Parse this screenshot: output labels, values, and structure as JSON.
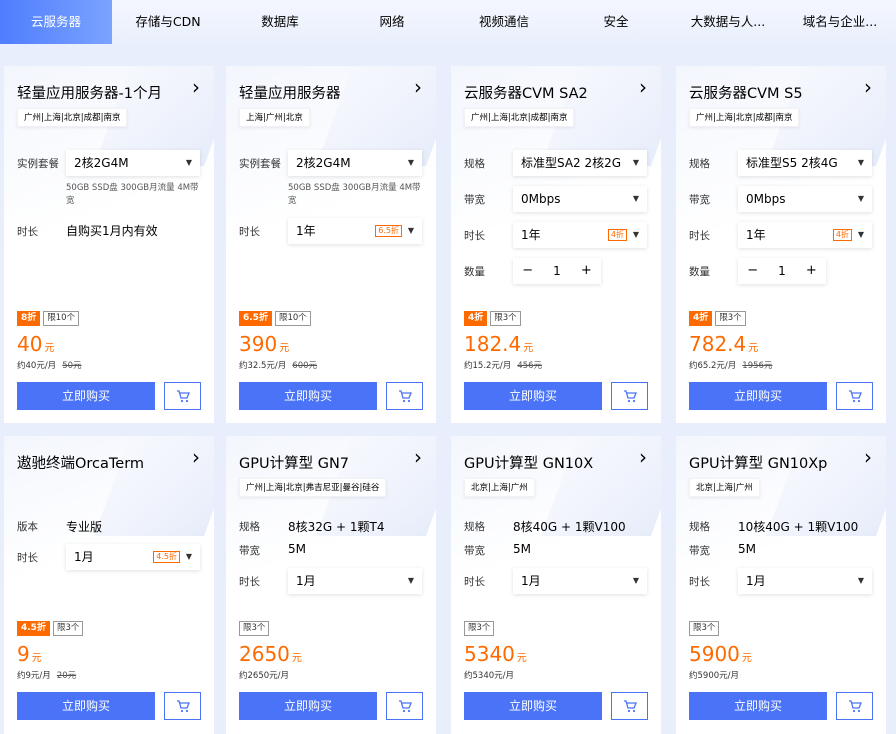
{
  "tabs": [
    "云服务器",
    "存储与CDN",
    "数据库",
    "网络",
    "视频通信",
    "安全",
    "大数据与人...",
    "域名与企业..."
  ],
  "cards": [
    {
      "title": "轻量应用服务器-1个月",
      "regions": "广州|上海|北京|成都|南京",
      "rows": [
        {
          "label": "实例套餐",
          "value": "2核2G4M",
          "type": "select"
        },
        {
          "label": "",
          "value": "50GB SSD盘 300GB月流量 4M带宽",
          "type": "spec"
        },
        {
          "label": "时长",
          "value": "自购买1月内有效",
          "type": "plain"
        }
      ],
      "badges": {
        "discount": "8折",
        "limit": "限10个"
      },
      "price": "40",
      "unit": "元",
      "per_month": "约40元/月",
      "original": "50元",
      "buy_label": "立即购买"
    },
    {
      "title": "轻量应用服务器",
      "regions": "上海|广州|北京",
      "rows": [
        {
          "label": "实例套餐",
          "value": "2核2G4M",
          "type": "select"
        },
        {
          "label": "",
          "value": "50GB SSD盘 300GB月流量 4M带宽",
          "type": "spec"
        },
        {
          "label": "时长",
          "value": "1年",
          "type": "select",
          "discount": "6.5折"
        }
      ],
      "badges": {
        "discount": "6.5折",
        "limit": "限10个"
      },
      "price": "390",
      "unit": "元",
      "per_month": "约32.5元/月",
      "original": "600元",
      "buy_label": "立即购买"
    },
    {
      "title": "云服务器CVM SA2",
      "regions": "广州|上海|北京|成都|南京",
      "rows": [
        {
          "label": "规格",
          "value": "标准型SA2 2核2G",
          "type": "select"
        },
        {
          "label": "带宽",
          "value": "0Mbps",
          "type": "select"
        },
        {
          "label": "时长",
          "value": "1年",
          "type": "select",
          "discount": "4折"
        },
        {
          "label": "数量",
          "value": "1",
          "type": "qty"
        }
      ],
      "badges": {
        "discount": "4折",
        "limit": "限3个"
      },
      "price": "182.4",
      "unit": "元",
      "per_month": "约15.2元/月",
      "original": "456元",
      "buy_label": "立即购买"
    },
    {
      "title": "云服务器CVM S5",
      "regions": "广州|上海|北京|成都|南京",
      "rows": [
        {
          "label": "规格",
          "value": "标准型S5 2核4G",
          "type": "select"
        },
        {
          "label": "带宽",
          "value": "0Mbps",
          "type": "select"
        },
        {
          "label": "时长",
          "value": "1年",
          "type": "select",
          "discount": "4折"
        },
        {
          "label": "数量",
          "value": "1",
          "type": "qty"
        }
      ],
      "badges": {
        "discount": "4折",
        "limit": "限3个"
      },
      "price": "782.4",
      "unit": "元",
      "per_month": "约65.2元/月",
      "original": "1956元",
      "buy_label": "立即购买"
    },
    {
      "title": "遨驰终端OrcaTerm",
      "regions": "",
      "rows": [
        {
          "label": "版本",
          "value": "专业版",
          "type": "plain"
        },
        {
          "label": "时长",
          "value": "1月",
          "type": "select",
          "discount": "4.5折"
        }
      ],
      "badges": {
        "discount": "4.5折",
        "limit": "限3个"
      },
      "price": "9",
      "unit": "元",
      "per_month": "约9元/月",
      "original": "20元",
      "buy_label": "立即购买"
    },
    {
      "title": "GPU计算型 GN7",
      "regions": "广州|上海|北京|弗吉尼亚|曼谷|硅谷",
      "rows": [
        {
          "label": "规格",
          "value": "8核32G + 1颗T4",
          "type": "plain"
        },
        {
          "label": "带宽",
          "value": "5M",
          "type": "plain"
        },
        {
          "label": "时长",
          "value": "1月",
          "type": "select"
        }
      ],
      "badges": {
        "discount": "",
        "limit": "限3个"
      },
      "price": "2650",
      "unit": "元",
      "per_month": "约2650元/月",
      "original": "",
      "buy_label": "立即购买"
    },
    {
      "title": "GPU计算型 GN10X",
      "regions": "北京|上海|广州",
      "rows": [
        {
          "label": "规格",
          "value": "8核40G + 1颗V100",
          "type": "plain"
        },
        {
          "label": "带宽",
          "value": "5M",
          "type": "plain"
        },
        {
          "label": "时长",
          "value": "1月",
          "type": "select"
        }
      ],
      "badges": {
        "discount": "",
        "limit": "限3个"
      },
      "price": "5340",
      "unit": "元",
      "per_month": "约5340元/月",
      "original": "",
      "buy_label": "立即购买"
    },
    {
      "title": "GPU计算型 GN10Xp",
      "regions": "北京|上海|广州",
      "rows": [
        {
          "label": "规格",
          "value": "10核40G + 1颗V100",
          "type": "plain"
        },
        {
          "label": "带宽",
          "value": "5M",
          "type": "plain"
        },
        {
          "label": "时长",
          "value": "1月",
          "type": "select"
        }
      ],
      "badges": {
        "discount": "",
        "limit": "限3个"
      },
      "price": "5900",
      "unit": "元",
      "per_month": "约5900元/月",
      "original": "",
      "buy_label": "立即购买"
    }
  ],
  "icons": {
    "arrow": "chevron-right-icon",
    "caret": "caret-down-icon",
    "cart": "cart-icon"
  },
  "colors": {
    "accent": "#4a73f7",
    "price": "#ff6a00"
  }
}
